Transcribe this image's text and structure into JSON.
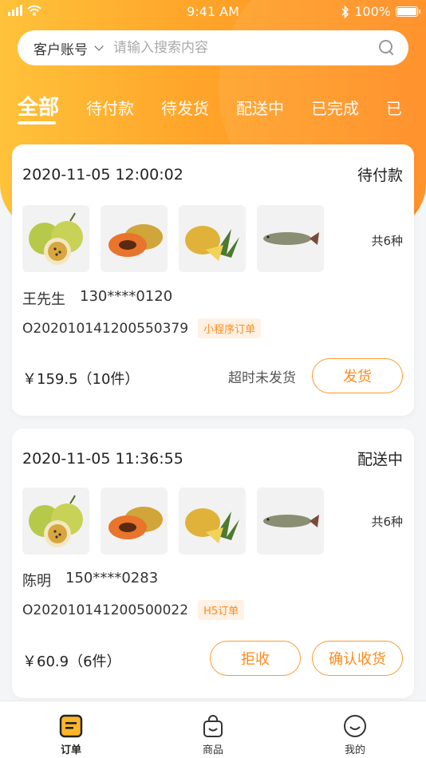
{
  "status_bar": {
    "time": "9:41 AM",
    "battery": "100%"
  },
  "search": {
    "type_label": "客户账号",
    "placeholder": "请输入搜索内容"
  },
  "tabs": [
    {
      "label": "全部"
    },
    {
      "label": "待付款"
    },
    {
      "label": "待发货"
    },
    {
      "label": "配送中"
    },
    {
      "label": "已完成"
    },
    {
      "label": "已"
    }
  ],
  "orders": [
    {
      "time": "2020-11-05 12:00:02",
      "status": "待付款",
      "kinds": "共6种",
      "customer_name": "王先生",
      "phone": "130****0120",
      "order_no": "O202010141200550379",
      "tag": "小程序订单",
      "price": "￥159.5（10件）",
      "overdue_text": "超时未发货",
      "buttons": [
        "发货"
      ]
    },
    {
      "time": "2020-11-05 11:36:55",
      "status": "配送中",
      "kinds": "共6种",
      "customer_name": "陈明",
      "phone": "150****0283",
      "order_no": "O202010141200500022",
      "tag": "H5订单",
      "price": "￥60.9（6件）",
      "buttons": [
        "拒收",
        "确认收货"
      ]
    }
  ],
  "tabbar": [
    {
      "label": "订单",
      "icon": "order-icon"
    },
    {
      "label": "商品",
      "icon": "bag-icon"
    },
    {
      "label": "我的",
      "icon": "smile-icon"
    }
  ],
  "colors": {
    "accent": "#ff8a1c",
    "hero_start": "#ffc23a",
    "hero_end": "#ff8a1c"
  }
}
